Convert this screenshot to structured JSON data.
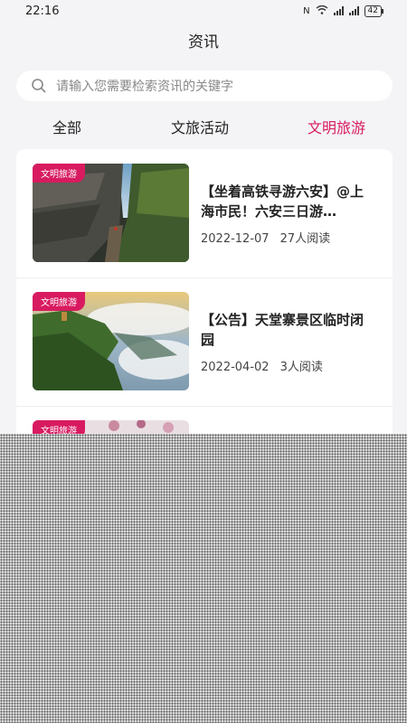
{
  "status": {
    "time": "22:16",
    "battery": "42"
  },
  "header": {
    "title": "资讯"
  },
  "search": {
    "placeholder": "请输入您需要检索资讯的关键字"
  },
  "tabs": [
    {
      "label": "全部",
      "active": false
    },
    {
      "label": "文旅活动",
      "active": false
    },
    {
      "label": "文明旅游",
      "active": true
    }
  ],
  "articles": [
    {
      "badge": "文明旅游",
      "title": "【坐着高铁寻游六安】@上海市民！六安三日游…",
      "date": "2022-12-07",
      "reads": "27人阅读"
    },
    {
      "badge": "文明旅游",
      "title": "【公告】天堂寨景区临时闭园",
      "date": "2022-04-02",
      "reads": "3人阅读"
    },
    {
      "badge": "文明旅游",
      "title": "",
      "date": "",
      "reads": ""
    }
  ],
  "colors": {
    "accent": "#d81b60",
    "background": "#f4f4f6"
  }
}
